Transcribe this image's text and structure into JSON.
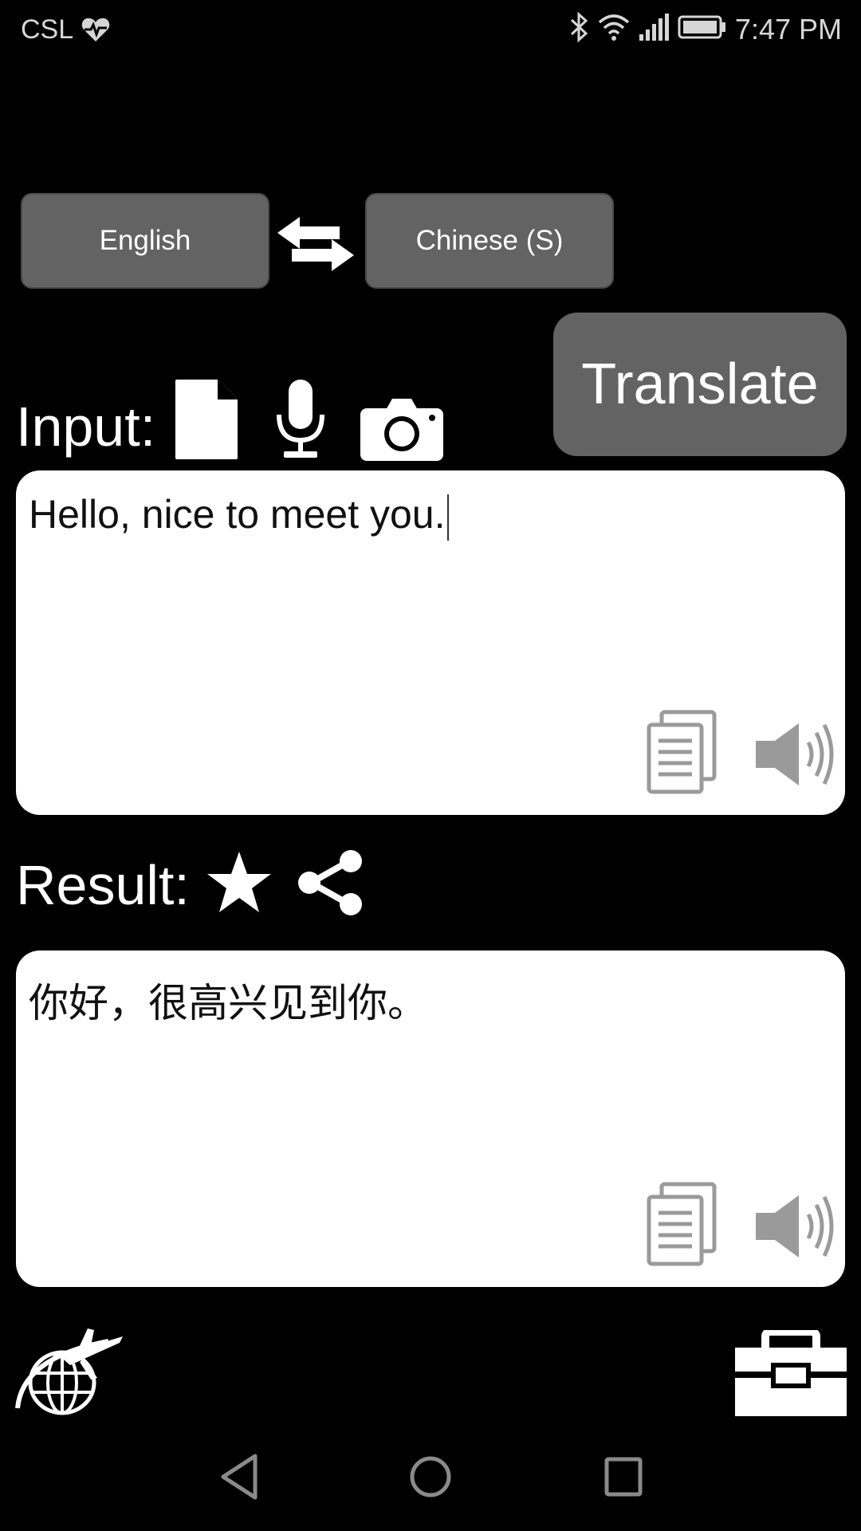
{
  "status_bar": {
    "carrier": "CSL",
    "time": "7:47 PM",
    "icons": [
      "heart-pulse-icon",
      "bluetooth-icon",
      "wifi-icon",
      "signal-icon",
      "battery-icon"
    ]
  },
  "languages": {
    "source": "English",
    "target": "Chinese (S)"
  },
  "translate_label": "Translate",
  "input": {
    "label": "Input:",
    "text": "Hello, nice to meet you."
  },
  "result": {
    "label": "Result:",
    "text": "你好，很高兴见到你。"
  },
  "colors": {
    "background": "#000000",
    "button_gray": "#636363",
    "textbox": "#ffffff",
    "icon_gray": "#9a9a9a"
  }
}
